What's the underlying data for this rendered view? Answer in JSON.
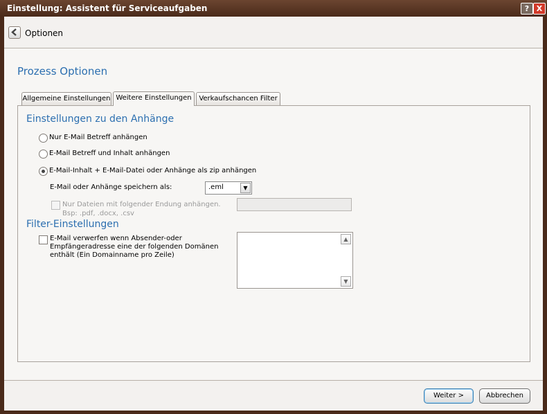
{
  "window": {
    "title": "Einstellung: Assistent für Serviceaufgaben",
    "help_glyph": "?",
    "close_glyph": "X"
  },
  "topbar": {
    "back_icon": "chevron-left-icon",
    "label": "Optionen"
  },
  "page": {
    "title": "Prozess Optionen"
  },
  "tabs": [
    {
      "label": "Allgemeine Einstellungen",
      "active": false
    },
    {
      "label": "Weitere Einstellungen",
      "active": true
    },
    {
      "label": "Verkaufschancen Filter",
      "active": false
    }
  ],
  "attachments": {
    "section_title": "Einstellungen zu den Anhänge",
    "options": [
      {
        "label": "Nur E-Mail Betreff anhängen",
        "selected": false
      },
      {
        "label": "E-Mail Betreff und Inhalt anhängen",
        "selected": false
      },
      {
        "label": "E-Mail-Inhalt + E-Mail-Datei oder Anhänge als zip anhängen",
        "selected": true
      }
    ],
    "save_as_label": "E-Mail oder Anhänge speichern als:",
    "save_as_value": ".eml",
    "only_ext_label_1": "Nur Dateien mit folgender Endung anhängen.",
    "only_ext_label_2": "Bsp: .pdf, .docx, .csv",
    "only_ext_value": ""
  },
  "filter": {
    "section_title": "Filter-Einstellungen",
    "discard_label_1": "E-Mail verwerfen wenn Absender-oder",
    "discard_label_2": "Empfängeradresse eine der folgenden Domänen",
    "discard_label_3": "enthält (Ein Domainname pro Zeile)",
    "domains_value": ""
  },
  "footer": {
    "next_label": "Weiter >",
    "cancel_label": "Abbrechen"
  },
  "colors": {
    "accent": "#2c6fb0",
    "titlebar": "#4a2a1a",
    "close": "#d23a2a"
  }
}
